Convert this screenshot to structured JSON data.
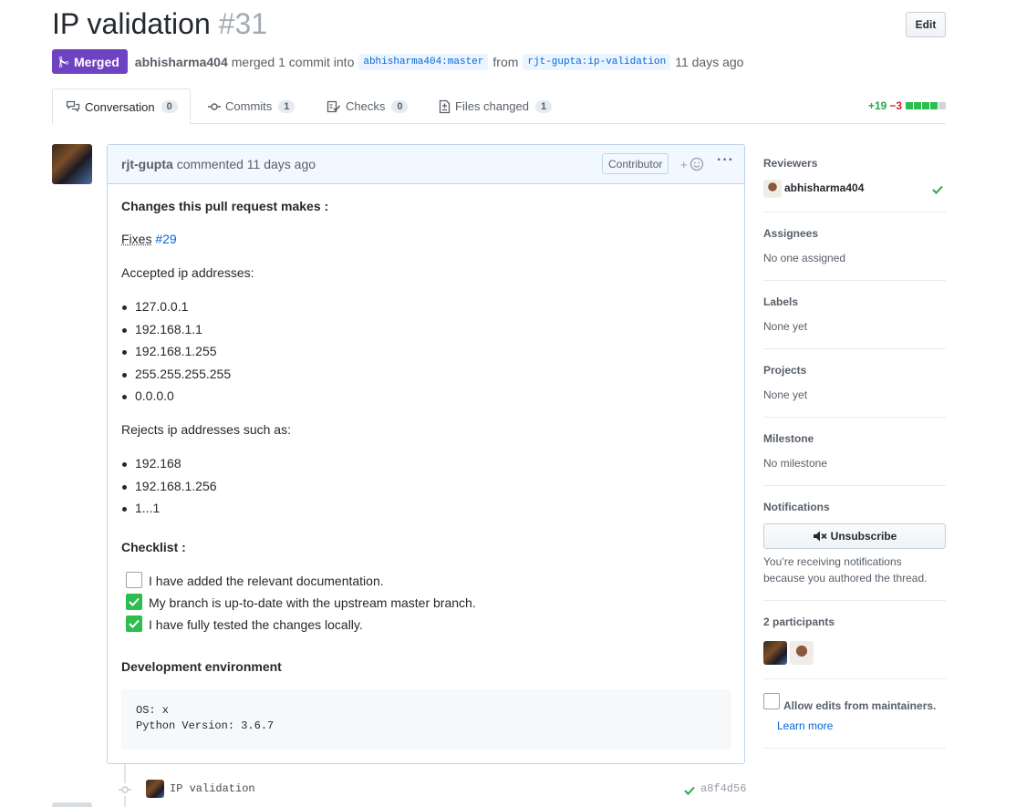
{
  "pr": {
    "title": "IP validation",
    "number": "#31",
    "edit_label": "Edit",
    "state_label": "Merged",
    "merger": "abhisharma404",
    "merge_text": "merged 1 commit into",
    "base_branch": "abhisharma404:master",
    "from_text": "from",
    "head_branch": "rjt-gupta:ip-validation",
    "time_ago": "11 days ago"
  },
  "tabs": [
    {
      "label": "Conversation",
      "count": "0",
      "icon": "comment-discussion-icon"
    },
    {
      "label": "Commits",
      "count": "1",
      "icon": "git-commit-icon"
    },
    {
      "label": "Checks",
      "count": "0",
      "icon": "checklist-icon"
    },
    {
      "label": "Files changed",
      "count": "1",
      "icon": "file-diff-icon"
    }
  ],
  "diffstat": {
    "additions": "+19",
    "deletions": "−3"
  },
  "comment": {
    "author": "rjt-gupta",
    "action": "commented 11 days ago",
    "role_badge": "Contributor",
    "reaction_plus": "+",
    "heading": "Changes this pull request makes :",
    "fixes_text": "Fixes",
    "fixes_link": "#29",
    "accepted_heading": "Accepted ip addresses:",
    "accepted": [
      "127.0.0.1",
      "192.168.1.1",
      "192.168.1.255",
      "255.255.255.255",
      "0.0.0.0"
    ],
    "rejected_heading": "Rejects ip addresses such as:",
    "rejected": [
      "192.168",
      "192.168.1.256",
      "1...1"
    ],
    "checklist_heading": "Checklist :",
    "checklist": [
      {
        "text": "I have added the relevant documentation.",
        "checked": false
      },
      {
        "text": "My branch is up-to-date with the upstream master branch.",
        "checked": true
      },
      {
        "text": "I have fully tested the changes locally.",
        "checked": true
      }
    ],
    "env_heading": "Development environment",
    "env_code": "OS: x\nPython Version: 3.6.7"
  },
  "commit": {
    "message": "IP validation",
    "sha": "a8f4d56"
  },
  "sidebar": {
    "reviewers_title": "Reviewers",
    "reviewer": "abhisharma404",
    "assignees_title": "Assignees",
    "assignees_value": "No one assigned",
    "labels_title": "Labels",
    "labels_value": "None yet",
    "projects_title": "Projects",
    "projects_value": "None yet",
    "milestone_title": "Milestone",
    "milestone_value": "No milestone",
    "notifications_title": "Notifications",
    "unsubscribe_label": "Unsubscribe",
    "notifications_text": "You’re receiving notifications because you authored the thread.",
    "participants_title": "2 participants",
    "maintainers_label": "Allow edits from maintainers.",
    "learn_more": "Learn more"
  },
  "colors": {
    "merged": "#6f42c1",
    "link": "#0366d6",
    "success": "#28a745",
    "danger": "#cb2431"
  }
}
